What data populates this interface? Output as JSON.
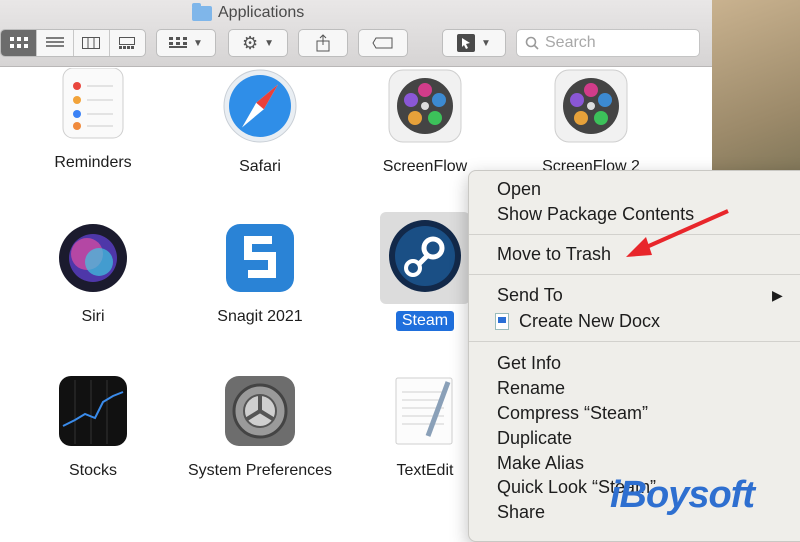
{
  "window": {
    "title": "Applications"
  },
  "toolbar": {
    "view_modes": [
      "icon-view",
      "list-view",
      "column-view",
      "gallery-view"
    ],
    "search_placeholder": "Search"
  },
  "apps": [
    {
      "name": "Reminders"
    },
    {
      "name": "Safari"
    },
    {
      "name": "ScreenFlow"
    },
    {
      "name": "ScreenFlow 2"
    },
    {
      "name": "Siri"
    },
    {
      "name": "Snagit 2021"
    },
    {
      "name": "Steam"
    },
    {
      "name": "Stocks"
    },
    {
      "name": "System Preferences"
    },
    {
      "name": "TextEdit"
    }
  ],
  "context_menu": {
    "open": "Open",
    "show_package": "Show Package Contents",
    "move_to_trash": "Move to Trash",
    "send_to": "Send To",
    "create_docx": "Create New Docx",
    "get_info": "Get Info",
    "rename": "Rename",
    "compress": "Compress “Steam”",
    "duplicate": "Duplicate",
    "make_alias": "Make Alias",
    "quick_look": "Quick Look “Steam”",
    "share": "Share"
  },
  "watermark": {
    "text": "iBoysoft"
  },
  "colors": {
    "selection": "#1f6fdc",
    "arrow": "#e8262b",
    "watermark": "#2e6fd0"
  }
}
